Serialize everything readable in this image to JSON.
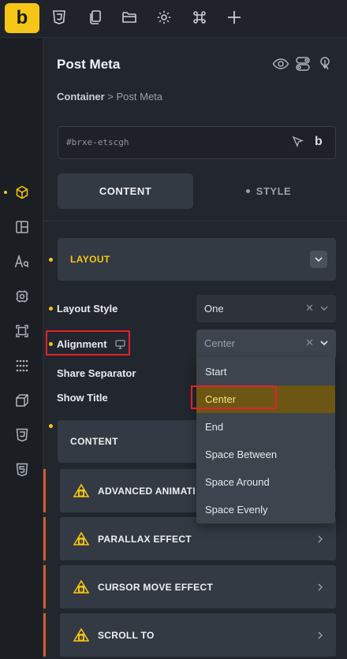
{
  "toolbar": {
    "logo": "b",
    "icons": [
      "css3-icon",
      "pages-icon",
      "folder-icon",
      "settings-icon",
      "command-icon",
      "add-icon"
    ]
  },
  "rail": {
    "icons": [
      "box-icon",
      "layout-icon",
      "typography-icon",
      "component-icon",
      "frame-icon",
      "grid-dots-icon",
      "cube-icon",
      "css3-icon",
      "html5-icon"
    ]
  },
  "panel": {
    "title": "Post Meta",
    "breadcrumb_parent": "Container",
    "breadcrumb_sep": " > ",
    "breadcrumb_current": "Post Meta",
    "element_id": "#brxe-etscgh",
    "tabs": {
      "content": "CONTENT",
      "style": "STYLE"
    }
  },
  "layout_section": {
    "label": "LAYOUT"
  },
  "controls": {
    "layout_style": {
      "label": "Layout Style",
      "value": "One"
    },
    "alignment": {
      "label": "Alignment",
      "value": "Center"
    },
    "share_separator": {
      "label": "Share Separator"
    },
    "show_title": {
      "label": "Show Title"
    }
  },
  "dropdown": {
    "options": [
      "Start",
      "Center",
      "End",
      "Space Between",
      "Space Around",
      "Space Evenly"
    ],
    "selected": "Center"
  },
  "content_section": {
    "label": "CONTENT"
  },
  "extensions": [
    {
      "label": "ADVANCED ANIMATI"
    },
    {
      "label": "PARALLAX EFFECT"
    },
    {
      "label": "CURSOR MOVE EFFECT"
    },
    {
      "label": "SCROLL TO"
    }
  ],
  "colors": {
    "accent": "#f5c518",
    "highlight_box": "#e0222a",
    "selected_option": "#6b5713",
    "extension_accent": "#d45a2e"
  }
}
